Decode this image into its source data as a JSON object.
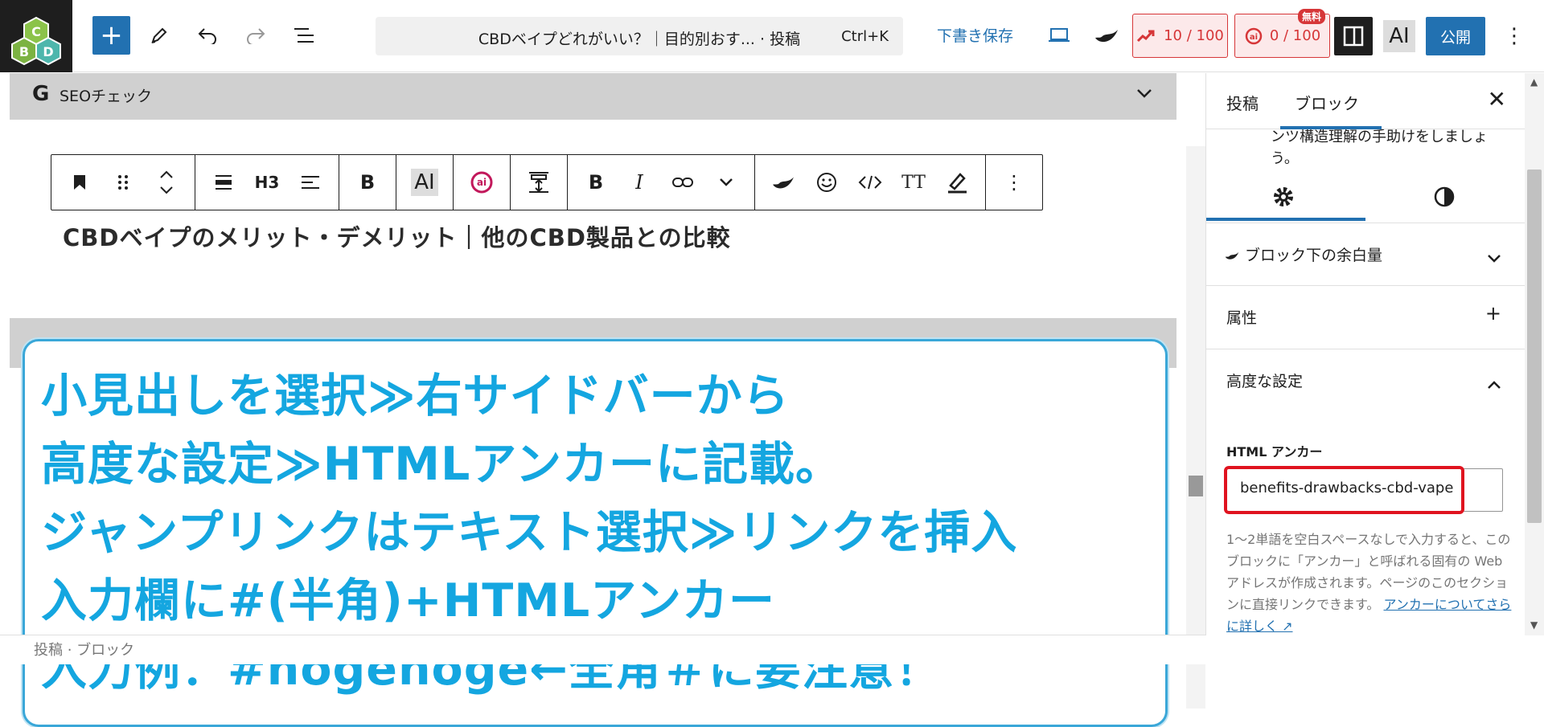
{
  "topbar": {
    "command_title": "CBDベイプどれがいい？｜目的別おす... · 投稿",
    "command_shortcut": "Ctrl+K",
    "draft_label": "下書き保存",
    "score1": "10 / 100",
    "score2": "0 / 100",
    "free_badge": "無料",
    "ai_label": "AI",
    "publish_label": "公開"
  },
  "editor": {
    "seo_label": "SEOチェック",
    "heading": "CBDベイプのメリット・デメリット｜他のCBD製品との比較",
    "toolbar_h3": "H3",
    "toolbar_ai": "AI",
    "callout_lines": [
      "小見出しを選択≫右サイドバーから",
      "高度な設定≫HTMLアンカーに記載。",
      "ジャンプリンクはテキスト選択≫リンクを挿入",
      "入力欄に#(半角)+HTMLアンカー",
      "入力例：#hogehoge←全角＃に要注意！"
    ],
    "bottom_text": "投稿 · ブロック"
  },
  "sidebar": {
    "tab_post": "投稿",
    "tab_block": "ブロック",
    "description": "ンツ構造理解の手助けをしましょう。",
    "section_spacing": "ブロック下の余白量",
    "section_attributes": "属性",
    "section_advanced": "高度な設定",
    "html_anchor_label": "HTML アンカー",
    "html_anchor_value": "benefits-drawbacks-cbd-vape",
    "help_text": "1〜2単語を空白スペースなしで入力すると、このブロックに「アンカー」と呼ばれる固有の Web アドレスが作成されます。ページのこのセクションに直接リンクできます。",
    "help_link": "アンカーについてさらに詳しく ↗"
  },
  "colors": {
    "accent": "#2271b1",
    "callout_text": "#14a6e0",
    "highlight": "#e0131f"
  }
}
